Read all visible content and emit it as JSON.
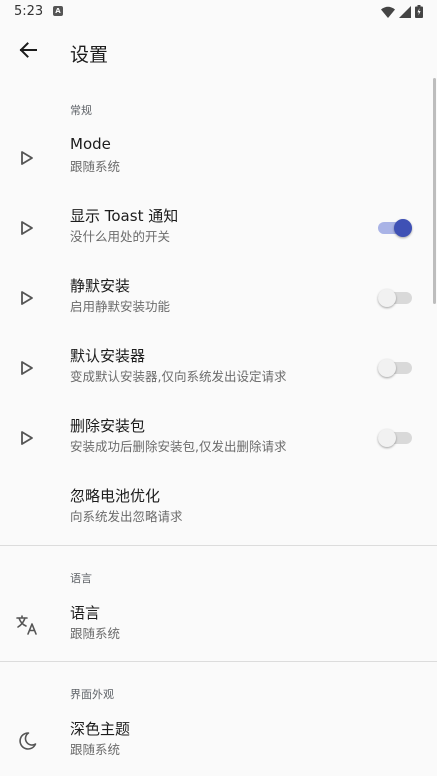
{
  "status_bar": {
    "time": "5:23",
    "notification_letter": "A"
  },
  "app_bar": {
    "title": "设置"
  },
  "sections": {
    "general": {
      "header": "常规",
      "items": [
        {
          "title": "Mode",
          "summary": "跟随系统",
          "icon": "play-outline-icon"
        },
        {
          "title": "显示 Toast 通知",
          "summary": "没什么用处的开关",
          "icon": "play-outline-icon",
          "switch_on": true
        },
        {
          "title": "静默安装",
          "summary": "启用静默安装功能",
          "icon": "play-outline-icon",
          "switch_on": false
        },
        {
          "title": "默认安装器",
          "summary": "变成默认安装器,仅向系统发出设定请求",
          "icon": "play-outline-icon",
          "switch_on": false
        },
        {
          "title": "删除安装包",
          "summary": "安装成功后删除安装包,仅发出删除请求",
          "icon": "play-outline-icon",
          "switch_on": false
        },
        {
          "title": "忽略电池优化",
          "summary": "向系统发出忽略请求"
        }
      ]
    },
    "language": {
      "header": "语言",
      "items": [
        {
          "title": "语言",
          "summary": "跟随系统",
          "icon": "translate-icon"
        }
      ]
    },
    "appearance": {
      "header": "界面外观",
      "items": [
        {
          "title": "深色主题",
          "summary": "跟随系统",
          "icon": "moon-icon"
        }
      ]
    }
  },
  "colors": {
    "accent": "#3f51b5",
    "accent_track": "#a9b3e6",
    "background": "#fafafa"
  }
}
